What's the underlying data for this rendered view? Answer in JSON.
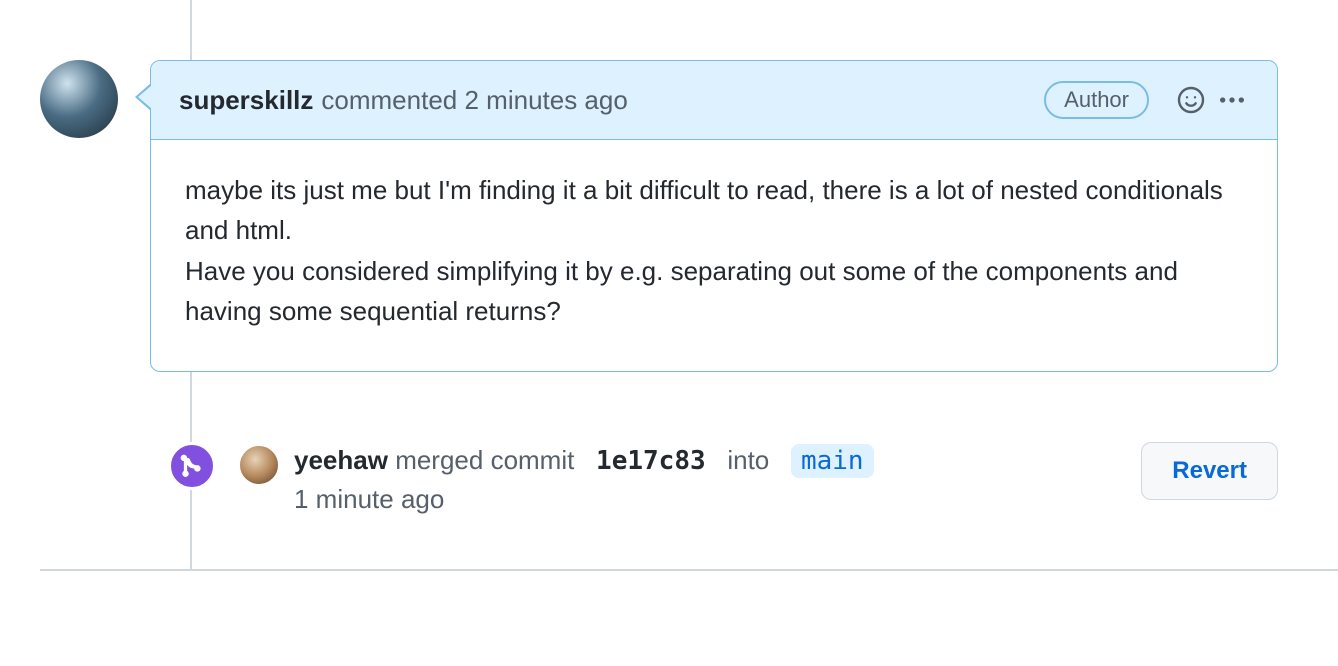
{
  "comment": {
    "user": "superskillz",
    "action": "commented",
    "time": "2 minutes ago",
    "author_badge": "Author",
    "body_p1": "maybe its just me but I'm finding it a bit difficult to read, there is a lot of nested conditionals and html.",
    "body_p2": "Have you considered simplifying it by e.g. separating out some of the components and having some sequential returns?"
  },
  "merge_event": {
    "user": "yeehaw",
    "verb": "merged commit",
    "commit": "1e17c83",
    "into_word": "into",
    "branch": "main",
    "time": "1 minute ago",
    "revert_label": "Revert"
  }
}
